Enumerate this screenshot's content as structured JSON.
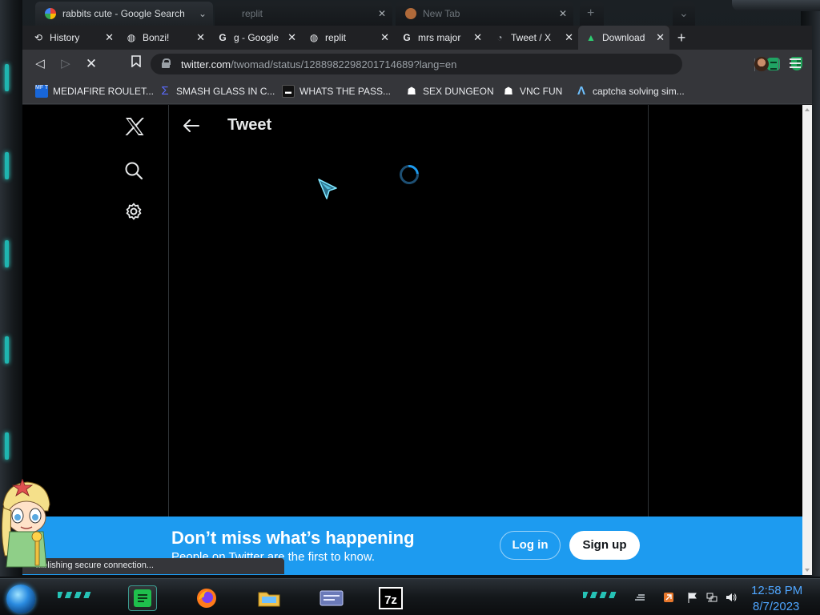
{
  "background_tabs": [
    {
      "label": "rabbits cute - Google Search"
    },
    {
      "label": "replit"
    },
    {
      "label": "New Tab"
    }
  ],
  "tabs": [
    {
      "label": "History",
      "icon": "history-icon"
    },
    {
      "label": "Bonzi!",
      "icon": "globe-icon"
    },
    {
      "label": "g - Google",
      "icon": "google-icon"
    },
    {
      "label": "replit",
      "icon": "globe-icon"
    },
    {
      "label": "mrs major",
      "icon": "google-icon"
    },
    {
      "label": "Tweet / X",
      "icon": "loading-icon"
    },
    {
      "label": "Download",
      "icon": "arc-icon"
    }
  ],
  "address_bar": {
    "host": "twitter.com",
    "path": "/twomad/status/1288982298201714689?lang=en"
  },
  "bookmarks": [
    {
      "label": "MEDIAFIRE ROULET...",
      "icon_text": "MF T"
    },
    {
      "label": "SMASH GLASS IN C..."
    },
    {
      "label": "WHATS THE PASS..."
    },
    {
      "label": "SEX DUNGEON"
    },
    {
      "label": "VNC FUN"
    },
    {
      "label": "captcha solving sim..."
    }
  ],
  "page": {
    "header_title": "Tweet",
    "banner": {
      "title": "Don’t miss what’s happening",
      "subtitle": "People on Twitter are the first to know.",
      "login_label": "Log in",
      "signup_label": "Sign up"
    }
  },
  "status_text": "tablishing secure connection...",
  "clock": {
    "time": "12:58 PM",
    "date": "8/7/2023"
  },
  "colors": {
    "twitter_blue": "#1d9bf0",
    "chrome_dark": "#202124",
    "toolbar": "#35363a",
    "clock_blue": "#4fa6ff"
  }
}
